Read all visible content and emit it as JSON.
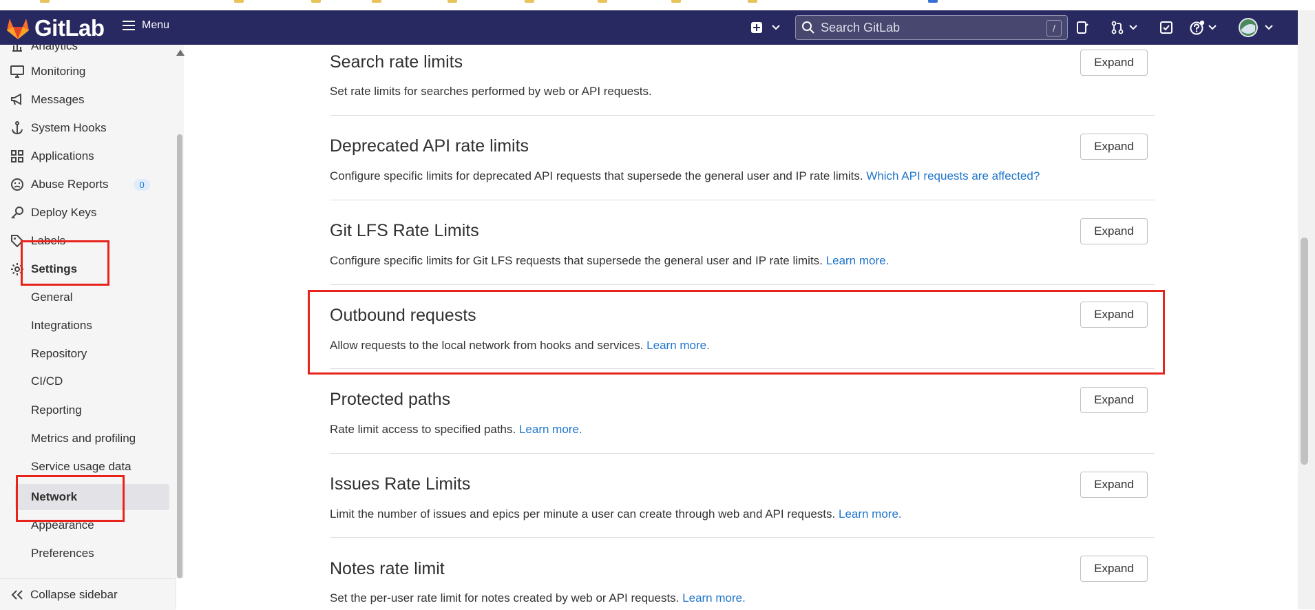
{
  "browser": {
    "strip_colors": [
      "#e8c35a",
      "#3b6fd8"
    ]
  },
  "navbar": {
    "brand": "GitLab",
    "menu_label": "Menu",
    "search_placeholder": "Search GitLab",
    "search_shortcut": "/",
    "background": "#292961",
    "icons": [
      "plus-square-icon",
      "chevron-down-icon",
      "issues-icon",
      "merge-request-icon",
      "todo-icon",
      "help-icon",
      "avatar"
    ]
  },
  "sidebar": {
    "partial_top_item": "Analytics",
    "items": [
      {
        "label": "Monitoring",
        "icon": "monitor-icon"
      },
      {
        "label": "Messages",
        "icon": "megaphone-icon"
      },
      {
        "label": "System Hooks",
        "icon": "anchor-icon"
      },
      {
        "label": "Applications",
        "icon": "applications-icon"
      },
      {
        "label": "Abuse Reports",
        "icon": "abuse-icon",
        "badge": "0"
      },
      {
        "label": "Deploy Keys",
        "icon": "key-icon"
      },
      {
        "label": "Labels",
        "icon": "label-icon"
      },
      {
        "label": "Settings",
        "icon": "gear-icon"
      }
    ],
    "settings_subitems": [
      "General",
      "Integrations",
      "Repository",
      "CI/CD",
      "Reporting",
      "Metrics and profiling",
      "Service usage data",
      "Network",
      "Appearance",
      "Preferences"
    ],
    "active_item": "Network",
    "collapse_label": "Collapse sidebar"
  },
  "sections": [
    {
      "title": "Search rate limits",
      "desc": "Set rate limits for searches performed by web or API requests.",
      "link": "",
      "button": "Expand"
    },
    {
      "title": "Deprecated API rate limits",
      "desc": "Configure specific limits for deprecated API requests that supersede the general user and IP rate limits.",
      "link": "Which API requests are affected?",
      "button": "Expand"
    },
    {
      "title": "Git LFS Rate Limits",
      "desc": "Configure specific limits for Git LFS requests that supersede the general user and IP rate limits.",
      "link": "Learn more.",
      "button": "Expand"
    },
    {
      "title": "Outbound requests",
      "desc": "Allow requests to the local network from hooks and services.",
      "link": "Learn more.",
      "button": "Expand"
    },
    {
      "title": "Protected paths",
      "desc": "Rate limit access to specified paths.",
      "link": "Learn more.",
      "button": "Expand"
    },
    {
      "title": "Issues Rate Limits",
      "desc": "Limit the number of issues and epics per minute a user can create through web and API requests.",
      "link": "Learn more.",
      "button": "Expand"
    },
    {
      "title": "Notes rate limit",
      "desc": "Set the per-user rate limit for notes created by web or API requests.",
      "link": "Learn more.",
      "button": "Expand"
    }
  ],
  "colors": {
    "link": "#1f75cb",
    "annotation_red": "#e8231b",
    "brand_orange": "#fc6d26"
  }
}
